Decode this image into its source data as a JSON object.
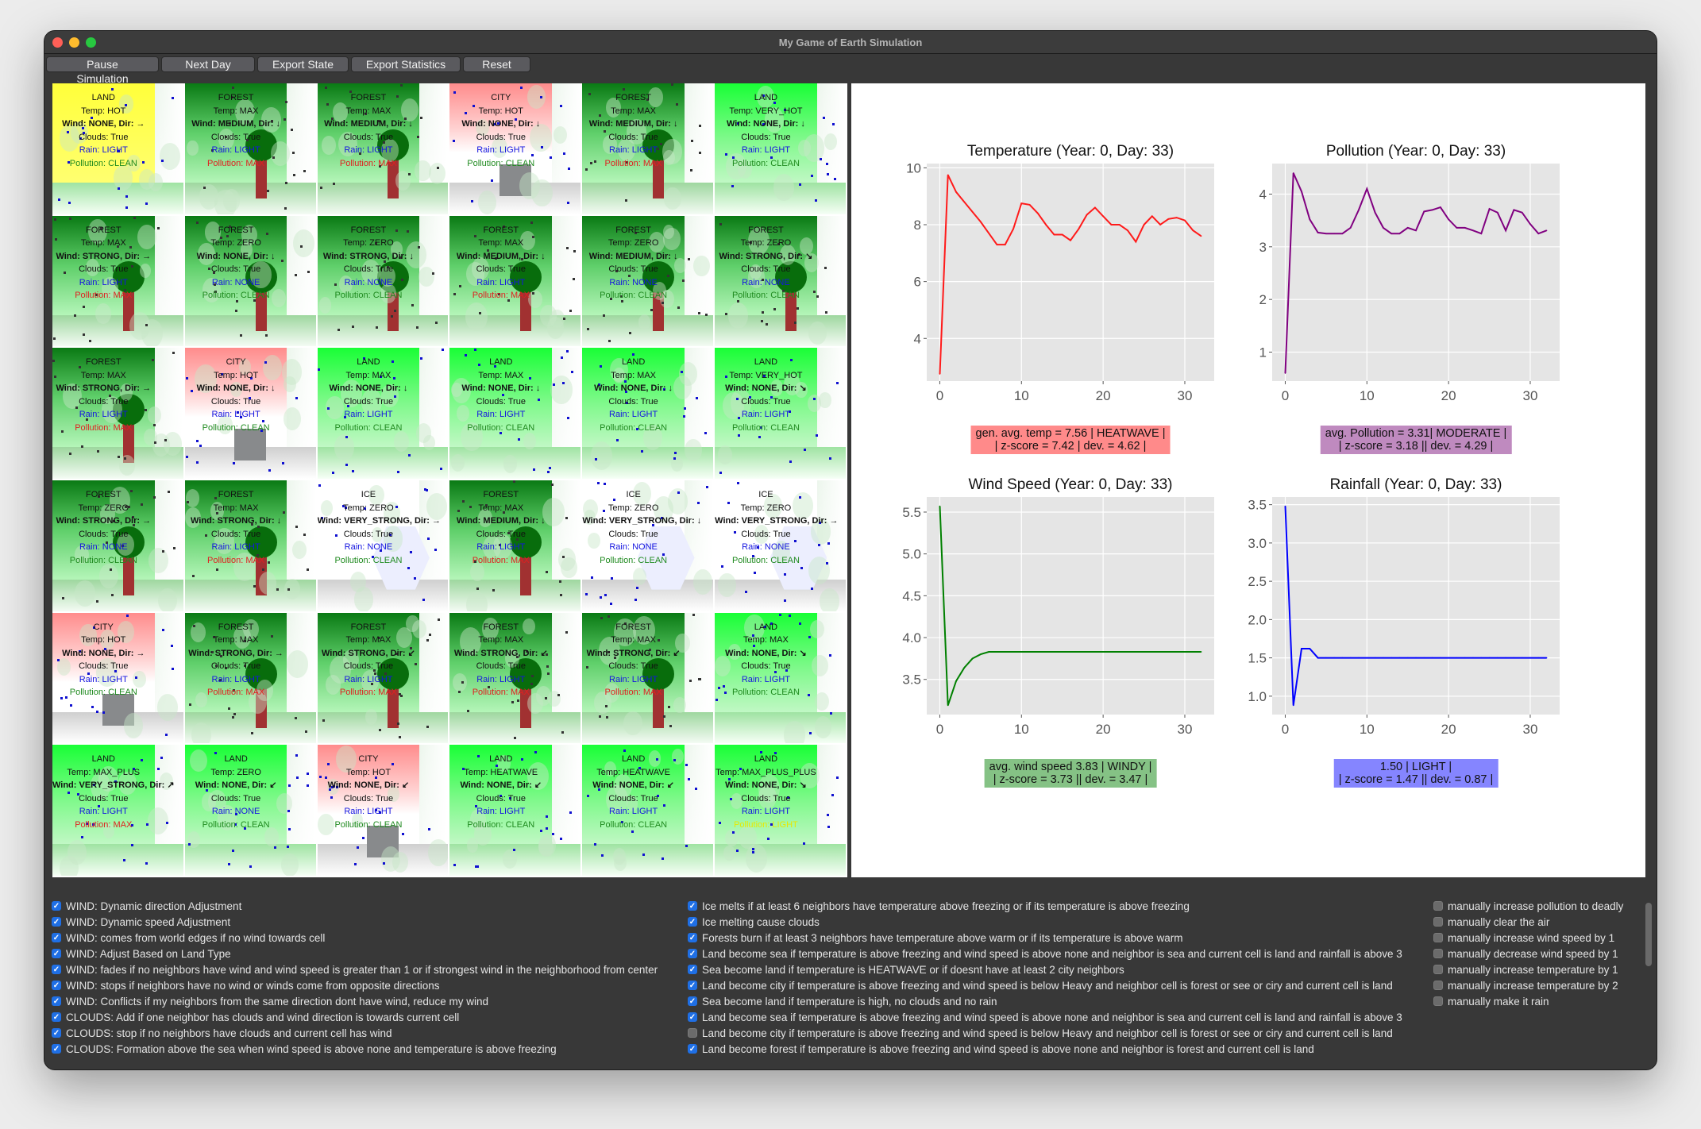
{
  "window": {
    "title": "My Game of Earth Simulation",
    "traffic_lights": [
      {
        "name": "close",
        "color": "#ff5f57"
      },
      {
        "name": "minimize",
        "color": "#febc2e"
      },
      {
        "name": "zoom",
        "color": "#28c840"
      }
    ]
  },
  "toolbar": {
    "pause_label": "Pause Simulation",
    "next_day_label": "Next Day",
    "export_state_label": "Export State",
    "export_statistics_label": "Export Statistics",
    "reset_label": "Reset"
  },
  "grid": {
    "labels": {
      "temp": "Temp: ",
      "wind": "Wind: ",
      "dir": ", Dir: ",
      "clouds": "Clouds: ",
      "rain": "Rain: ",
      "pollution": "Pollution: "
    },
    "cells": [
      {
        "type": "LAND",
        "temp": "HOT",
        "wind": "NONE",
        "dir": "→",
        "clouds": "True",
        "rain": "LIGHT",
        "pollution": "CLEAN"
      },
      {
        "type": "FOREST",
        "temp": "MAX",
        "wind": "MEDIUM",
        "dir": "↓",
        "clouds": "True",
        "rain": "LIGHT",
        "pollution": "MAX"
      },
      {
        "type": "FOREST",
        "temp": "MAX",
        "wind": "MEDIUM",
        "dir": "↓",
        "clouds": "True",
        "rain": "LIGHT",
        "pollution": "MAX"
      },
      {
        "type": "CITY",
        "temp": "HOT",
        "wind": "NONE",
        "dir": "↓",
        "clouds": "True",
        "rain": "LIGHT",
        "pollution": "CLEAN"
      },
      {
        "type": "FOREST",
        "temp": "MAX",
        "wind": "MEDIUM",
        "dir": "↓",
        "clouds": "True",
        "rain": "LIGHT",
        "pollution": "MAX"
      },
      {
        "type": "LAND",
        "temp": "VERY_HOT",
        "wind": "NONE",
        "dir": "↓",
        "clouds": "True",
        "rain": "LIGHT",
        "pollution": "CLEAN"
      },
      {
        "type": "FOREST",
        "temp": "MAX",
        "wind": "STRONG",
        "dir": "→",
        "clouds": "True",
        "rain": "LIGHT",
        "pollution": "MAX"
      },
      {
        "type": "FOREST",
        "temp": "ZERO",
        "wind": "NONE",
        "dir": "↓",
        "clouds": "True",
        "rain": "NONE",
        "pollution": "CLEAN"
      },
      {
        "type": "FOREST",
        "temp": "ZERO",
        "wind": "STRONG",
        "dir": "↓",
        "clouds": "True",
        "rain": "NONE",
        "pollution": "CLEAN"
      },
      {
        "type": "FOREST",
        "temp": "MAX",
        "wind": "MEDIUM",
        "dir": "↓",
        "clouds": "True",
        "rain": "LIGHT",
        "pollution": "MAX"
      },
      {
        "type": "FOREST",
        "temp": "ZERO",
        "wind": "MEDIUM",
        "dir": "↓",
        "clouds": "True",
        "rain": "NONE",
        "pollution": "CLEAN"
      },
      {
        "type": "FOREST",
        "temp": "ZERO",
        "wind": "STRONG",
        "dir": "↘",
        "clouds": "True",
        "rain": "NONE",
        "pollution": "CLEAN"
      },
      {
        "type": "FOREST",
        "temp": "MAX",
        "wind": "STRONG",
        "dir": "→",
        "clouds": "True",
        "rain": "LIGHT",
        "pollution": "MAX"
      },
      {
        "type": "CITY",
        "temp": "HOT",
        "wind": "NONE",
        "dir": "↓",
        "clouds": "True",
        "rain": "LIGHT",
        "pollution": "CLEAN"
      },
      {
        "type": "LAND",
        "temp": "MAX",
        "wind": "NONE",
        "dir": "↓",
        "clouds": "True",
        "rain": "LIGHT",
        "pollution": "CLEAN"
      },
      {
        "type": "LAND",
        "temp": "MAX",
        "wind": "NONE",
        "dir": "↓",
        "clouds": "True",
        "rain": "LIGHT",
        "pollution": "CLEAN"
      },
      {
        "type": "LAND",
        "temp": "MAX",
        "wind": "NONE",
        "dir": "↓",
        "clouds": "True",
        "rain": "LIGHT",
        "pollution": "CLEAN"
      },
      {
        "type": "LAND",
        "temp": "VERY_HOT",
        "wind": "NONE",
        "dir": "↘",
        "clouds": "True",
        "rain": "LIGHT",
        "pollution": "CLEAN"
      },
      {
        "type": "FOREST",
        "temp": "ZERO",
        "wind": "STRONG",
        "dir": "→",
        "clouds": "True",
        "rain": "NONE",
        "pollution": "CLEAN"
      },
      {
        "type": "FOREST",
        "temp": "MAX",
        "wind": "STRONG",
        "dir": "↓",
        "clouds": "True",
        "rain": "LIGHT",
        "pollution": "MAX"
      },
      {
        "type": "ICE",
        "temp": "ZERO",
        "wind": "VERY_STRONG",
        "dir": "→",
        "clouds": "True",
        "rain": "NONE",
        "pollution": "CLEAN"
      },
      {
        "type": "FOREST",
        "temp": "MAX",
        "wind": "MEDIUM",
        "dir": "↓",
        "clouds": "True",
        "rain": "LIGHT",
        "pollution": "MAX"
      },
      {
        "type": "ICE",
        "temp": "ZERO",
        "wind": "VERY_STRONG",
        "dir": "↓",
        "clouds": "True",
        "rain": "NONE",
        "pollution": "CLEAN"
      },
      {
        "type": "ICE",
        "temp": "ZERO",
        "wind": "VERY_STRONG",
        "dir": "→",
        "clouds": "True",
        "rain": "NONE",
        "pollution": "CLEAN"
      },
      {
        "type": "CITY",
        "temp": "HOT",
        "wind": "NONE",
        "dir": "→",
        "clouds": "True",
        "rain": "LIGHT",
        "pollution": "CLEAN"
      },
      {
        "type": "FOREST",
        "temp": "MAX",
        "wind": "STRONG",
        "dir": "→",
        "clouds": "True",
        "rain": "LIGHT",
        "pollution": "MAX"
      },
      {
        "type": "FOREST",
        "temp": "MAX",
        "wind": "STRONG",
        "dir": "↙",
        "clouds": "True",
        "rain": "LIGHT",
        "pollution": "MAX"
      },
      {
        "type": "FOREST",
        "temp": "MAX",
        "wind": "STRONG",
        "dir": "↙",
        "clouds": "True",
        "rain": "LIGHT",
        "pollution": "MAX"
      },
      {
        "type": "FOREST",
        "temp": "MAX",
        "wind": "STRONG",
        "dir": "↙",
        "clouds": "True",
        "rain": "LIGHT",
        "pollution": "MAX"
      },
      {
        "type": "LAND",
        "temp": "MAX",
        "wind": "NONE",
        "dir": "↘",
        "clouds": "True",
        "rain": "LIGHT",
        "pollution": "CLEAN"
      },
      {
        "type": "LAND",
        "temp": "MAX_PLUS",
        "wind": "VERY_STRONG",
        "dir": "↗",
        "clouds": "True",
        "rain": "LIGHT",
        "pollution": "MAX"
      },
      {
        "type": "LAND",
        "temp": "ZERO",
        "wind": "NONE",
        "dir": "↙",
        "clouds": "True",
        "rain": "NONE",
        "pollution": "CLEAN"
      },
      {
        "type": "CITY",
        "temp": "HOT",
        "wind": "NONE",
        "dir": "↙",
        "clouds": "True",
        "rain": "LIGHT",
        "pollution": "CLEAN"
      },
      {
        "type": "LAND",
        "temp": "HEATWAVE",
        "wind": "NONE",
        "dir": "↙",
        "clouds": "True",
        "rain": "LIGHT",
        "pollution": "CLEAN"
      },
      {
        "type": "LAND",
        "temp": "HEATWAVE",
        "wind": "NONE",
        "dir": "↙",
        "clouds": "True",
        "rain": "LIGHT",
        "pollution": "CLEAN"
      },
      {
        "type": "LAND",
        "temp": "MAX_PLUS_PLUS",
        "wind": "NONE",
        "dir": "↘",
        "clouds": "True",
        "rain": "LIGHT",
        "pollution": "LIGHT"
      }
    ]
  },
  "chart_data": [
    {
      "type": "line",
      "title": "Temperature (Year: 0, Day: 33)",
      "xlabel": "",
      "ylabel": "",
      "color": "#ff1a1a",
      "xlim": [
        -1.6,
        33.6
      ],
      "ylim": [
        2.5,
        10.15
      ],
      "xticks": [
        0,
        10,
        20,
        30
      ],
      "yticks": [
        4,
        6,
        8,
        10
      ],
      "grid": true,
      "x": [
        0,
        1,
        2,
        3,
        4,
        5,
        6,
        7,
        8,
        9,
        10,
        11,
        12,
        13,
        14,
        15,
        16,
        17,
        18,
        19,
        20,
        21,
        22,
        23,
        24,
        25,
        26,
        27,
        28,
        29,
        30,
        31,
        32
      ],
      "values": [
        2.75,
        9.75,
        9.15,
        8.8,
        8.45,
        8.1,
        7.7,
        7.3,
        7.3,
        7.85,
        8.75,
        8.7,
        8.4,
        8.0,
        7.65,
        7.65,
        7.45,
        7.85,
        8.35,
        8.6,
        8.3,
        8.0,
        8.0,
        7.8,
        7.4,
        8.0,
        8.3,
        8.0,
        8.2,
        8.25,
        8.15,
        7.8,
        7.6
      ],
      "stat_box": {
        "line1": "gen. avg. temp = 7.56 | HEATWAVE |",
        "line2": "| z-score = 7.42 | dev. = 4.62 |",
        "color": "#ff8a8a"
      }
    },
    {
      "type": "line",
      "title": "Pollution (Year: 0, Day: 33)",
      "xlabel": "",
      "ylabel": "",
      "color": "#800080",
      "xlim": [
        -1.6,
        33.6
      ],
      "ylim": [
        0.45,
        4.58
      ],
      "xticks": [
        0,
        10,
        20,
        30
      ],
      "yticks": [
        1,
        2,
        3,
        4
      ],
      "grid": true,
      "x": [
        0,
        1,
        2,
        3,
        4,
        5,
        6,
        7,
        8,
        9,
        10,
        11,
        12,
        13,
        14,
        15,
        16,
        17,
        18,
        19,
        20,
        21,
        22,
        23,
        24,
        25,
        26,
        27,
        28,
        29,
        30,
        31,
        32
      ],
      "values": [
        0.6,
        4.4,
        4.05,
        3.52,
        3.27,
        3.25,
        3.25,
        3.25,
        3.36,
        3.7,
        4.1,
        3.65,
        3.36,
        3.25,
        3.25,
        3.36,
        3.31,
        3.67,
        3.7,
        3.75,
        3.52,
        3.36,
        3.36,
        3.31,
        3.25,
        3.72,
        3.65,
        3.31,
        3.7,
        3.65,
        3.43,
        3.25,
        3.31
      ],
      "stat_box": {
        "line1": "avg. Pollution = 3.31| MODERATE |",
        "line2": "| z-score = 3.18 || dev. = 4.29 |",
        "color": "#bf8abf"
      }
    },
    {
      "type": "line",
      "title": "Wind Speed (Year: 0, Day: 33)",
      "xlabel": "",
      "ylabel": "",
      "color": "#008000",
      "xlim": [
        -1.6,
        33.6
      ],
      "ylim": [
        3.08,
        5.68
      ],
      "xticks": [
        0,
        10,
        20,
        30
      ],
      "yticks": [
        3.5,
        4.0,
        4.5,
        5.0,
        5.5
      ],
      "grid": true,
      "x": [
        0,
        1,
        2,
        3,
        4,
        5,
        6,
        7,
        8,
        9,
        10,
        11,
        12,
        13,
        14,
        15,
        16,
        17,
        18,
        19,
        20,
        21,
        22,
        23,
        24,
        25,
        26,
        27,
        28,
        29,
        30,
        31,
        32
      ],
      "values": [
        5.57,
        3.19,
        3.48,
        3.64,
        3.75,
        3.8,
        3.83,
        3.83,
        3.83,
        3.83,
        3.83,
        3.83,
        3.83,
        3.83,
        3.83,
        3.83,
        3.83,
        3.83,
        3.83,
        3.83,
        3.83,
        3.83,
        3.83,
        3.83,
        3.83,
        3.83,
        3.83,
        3.83,
        3.83,
        3.83,
        3.83,
        3.83,
        3.83
      ],
      "stat_box": {
        "line1": "avg. wind speed 3.83 | WINDY |",
        "line2": "| z-score = 3.73 || dev. = 3.47 |",
        "color": "#85c285"
      }
    },
    {
      "type": "line",
      "title": "Rainfall (Year: 0, Day: 33)",
      "xlabel": "",
      "ylabel": "",
      "color": "#0000ff",
      "xlim": [
        -1.6,
        33.6
      ],
      "ylim": [
        0.76,
        3.6
      ],
      "xticks": [
        0,
        10,
        20,
        30
      ],
      "yticks": [
        1.0,
        1.5,
        2.0,
        2.5,
        3.0,
        3.5
      ],
      "grid": true,
      "x": [
        0,
        1,
        2,
        3,
        4,
        5,
        6,
        7,
        8,
        9,
        10,
        11,
        12,
        13,
        14,
        15,
        16,
        17,
        18,
        19,
        20,
        21,
        22,
        23,
        24,
        25,
        26,
        27,
        28,
        29,
        30,
        31,
        32
      ],
      "values": [
        3.48,
        0.88,
        1.62,
        1.62,
        1.5,
        1.5,
        1.5,
        1.5,
        1.5,
        1.5,
        1.5,
        1.5,
        1.5,
        1.5,
        1.5,
        1.5,
        1.5,
        1.5,
        1.5,
        1.5,
        1.5,
        1.5,
        1.5,
        1.5,
        1.5,
        1.5,
        1.5,
        1.5,
        1.5,
        1.5,
        1.5,
        1.5,
        1.5
      ],
      "stat_box": {
        "line1": "1.50 | LIGHT |",
        "line2": "| z-score = 1.47 || dev. = 0.87 |",
        "color": "#8585ff"
      }
    }
  ],
  "rules": {
    "columns": [
      [
        {
          "label": "WIND: Dynamic direction Adjustment",
          "checked": true
        },
        {
          "label": "WIND: Dynamic speed Adjustment",
          "checked": true
        },
        {
          "label": "WIND: comes from world edges if no wind towards cell",
          "checked": true
        },
        {
          "label": "WIND: Adjust Based on Land Type",
          "checked": true
        },
        {
          "label": "WIND: fades if no neighbors have wind and wind speed is greater than 1 or if strongest wind in the neighborhood from center",
          "checked": true
        },
        {
          "label": "WIND: stops if neighbors have no wind or winds come from opposite directions",
          "checked": true
        },
        {
          "label": "WIND: Conflicts if my neighbors from the same direction dont have wind, reduce my wind",
          "checked": true
        },
        {
          "label": "CLOUDS: Add if one neighbor has clouds and wind direction is towards current cell",
          "checked": true
        },
        {
          "label": "CLOUDS: stop if no neighbors have clouds and current cell has wind",
          "checked": true
        },
        {
          "label": "CLOUDS: Formation above the sea when wind speed is above none and temperature is above freezing",
          "checked": true
        }
      ],
      [
        {
          "label": "Ice melts if at least 6 neighbors have temperature above freezing or if its temperature is above freezing",
          "checked": true
        },
        {
          "label": "Ice melting cause clouds",
          "checked": true
        },
        {
          "label": "Forests burn if at least 3 neighbors have temperature above warm or if its temperature is above warm",
          "checked": true
        },
        {
          "label": "Land become sea if temperature is above freezing and wind speed is above none and neighbor is sea and current cell is land and rainfall is above 3",
          "checked": true
        },
        {
          "label": "Sea become land if temperature is HEATWAVE or if doesnt have at least 2 city neighbors",
          "checked": true
        },
        {
          "label": "Land become city if temperature is above freezing and wind speed is below Heavy and neighbor cell is forest or see or ciry and current cell is land",
          "checked": true
        },
        {
          "label": "Sea become land if temperature is high, no clouds and no rain",
          "checked": true
        },
        {
          "label": "Land become sea if temperature is above freezing and wind speed is above none and neighbor is sea and current cell is land and rainfall is above 3",
          "checked": true
        },
        {
          "label": "Land become city if temperature is above freezing and wind speed is below Heavy and neighbor cell is forest or see or ciry and current cell is land",
          "checked": false
        },
        {
          "label": "Land become forest if temperature is above freezing and wind speed is above none and neighbor is forest and current cell is land",
          "checked": true
        }
      ],
      [
        {
          "label": "manually increase pollution to deadly",
          "checked": false
        },
        {
          "label": "manually clear the air",
          "checked": false
        },
        {
          "label": "manually increase wind speed by 1",
          "checked": false
        },
        {
          "label": "manually decrease wind speed by 1",
          "checked": false
        },
        {
          "label": "manually increase temperature by 1",
          "checked": false
        },
        {
          "label": "manually increase temperature by 2",
          "checked": false
        },
        {
          "label": "manually make it rain",
          "checked": false
        }
      ]
    ],
    "check_glyph": "✓"
  }
}
